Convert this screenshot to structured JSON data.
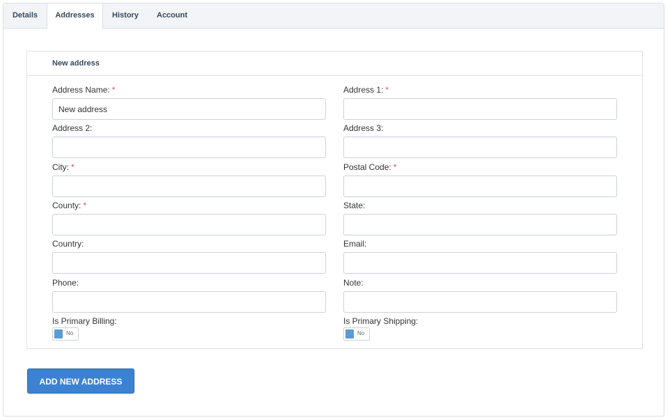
{
  "tabs": [
    {
      "label": "Details"
    },
    {
      "label": "Addresses"
    },
    {
      "label": "History"
    },
    {
      "label": "Account"
    }
  ],
  "active_tab": "Addresses",
  "panel": {
    "title": "New address"
  },
  "required_marker": "*",
  "fields": {
    "address_name": {
      "label": "Address Name:",
      "value": "New address",
      "required": true
    },
    "address1": {
      "label": "Address 1:",
      "value": "",
      "required": true
    },
    "address2": {
      "label": "Address 2:",
      "value": ""
    },
    "address3": {
      "label": "Address 3:",
      "value": ""
    },
    "city": {
      "label": "City:",
      "value": "",
      "required": true
    },
    "postal_code": {
      "label": "Postal Code:",
      "value": "",
      "required": true
    },
    "county": {
      "label": "County:",
      "value": "",
      "required": true
    },
    "state": {
      "label": "State:",
      "value": ""
    },
    "country": {
      "label": "Country:",
      "value": ""
    },
    "email": {
      "label": "Email:",
      "value": ""
    },
    "phone": {
      "label": "Phone:",
      "value": ""
    },
    "note": {
      "label": "Note:",
      "value": ""
    }
  },
  "toggles": {
    "primary_billing": {
      "label": "Is Primary Billing:",
      "state": "No"
    },
    "primary_shipping": {
      "label": "Is Primary Shipping:",
      "state": "No"
    }
  },
  "actions": {
    "add_label": "ADD NEW ADDRESS"
  },
  "colors": {
    "accent": "#3c82d0",
    "required": "#d9534f",
    "toggle_knob": "#5b9bd5",
    "tab_text": "#34495e"
  }
}
